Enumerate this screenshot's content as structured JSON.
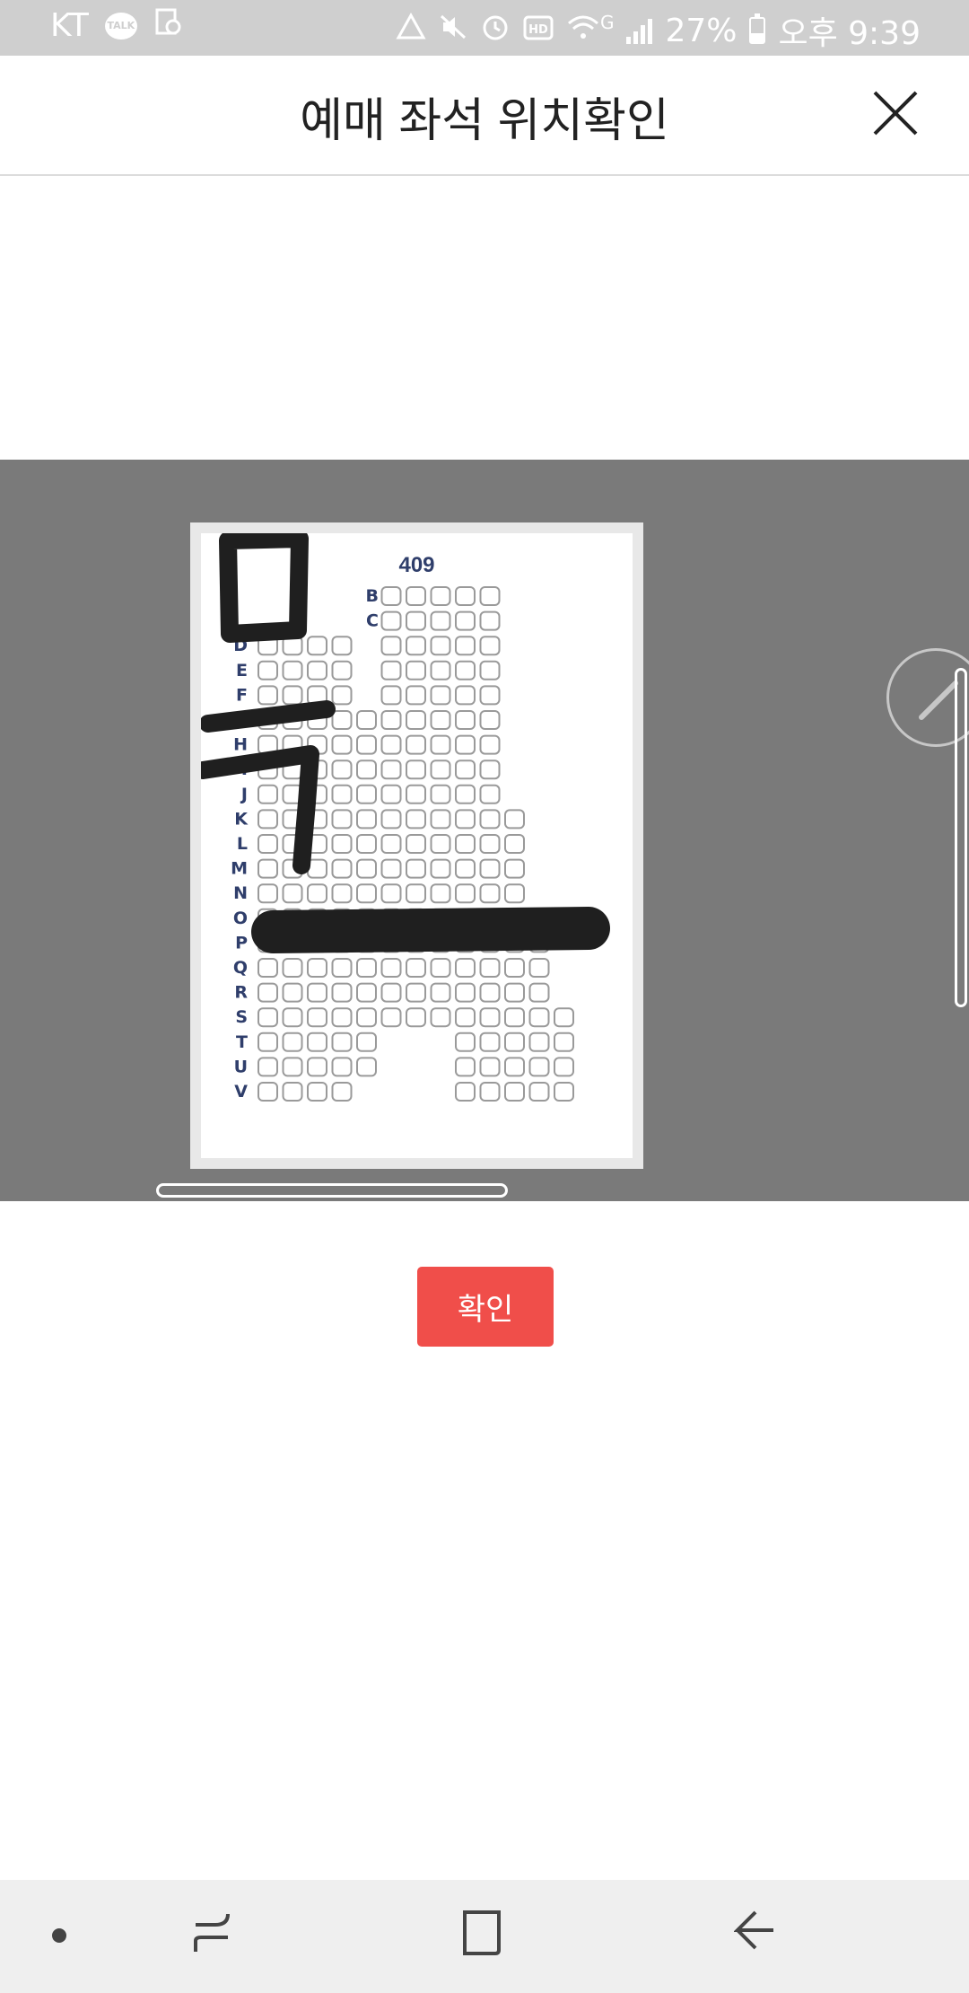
{
  "status_bar": {
    "carrier": "KT",
    "talk_badge": "TALK",
    "network": "G",
    "battery_percent": "27%",
    "clock": "오후 9:39",
    "icons": [
      "kakaotalk-icon",
      "screenshot-icon",
      "data-saver-icon",
      "mute-icon",
      "alarm-icon",
      "hd-icon",
      "wifi-icon",
      "signal-icon",
      "battery-icon"
    ]
  },
  "header": {
    "title": "예매 좌석 위치확인",
    "close_icon": "close-icon"
  },
  "seat_map": {
    "section": "409",
    "row_labels": [
      "B",
      "C",
      "D",
      "E",
      "F",
      "G",
      "H",
      "I",
      "J",
      "K",
      "L",
      "M",
      "N",
      "O",
      "P",
      "Q",
      "R",
      "S",
      "T",
      "U",
      "V"
    ],
    "handwritten": "목",
    "edit_icon": "pencil-icon"
  },
  "confirm": {
    "label": "확인"
  },
  "nav": {
    "items": [
      "dot-icon",
      "recent-apps-icon",
      "home-icon",
      "back-icon"
    ]
  },
  "colors": {
    "status_bar": "#cfcfcf",
    "viewer_bg": "#7a7a7a",
    "confirm": "#f04e4a",
    "row_label": "#2f3e6b",
    "seat_outline": "#9a9a9a",
    "scribble": "#1f1f1f",
    "nav_bg": "#efefef"
  }
}
